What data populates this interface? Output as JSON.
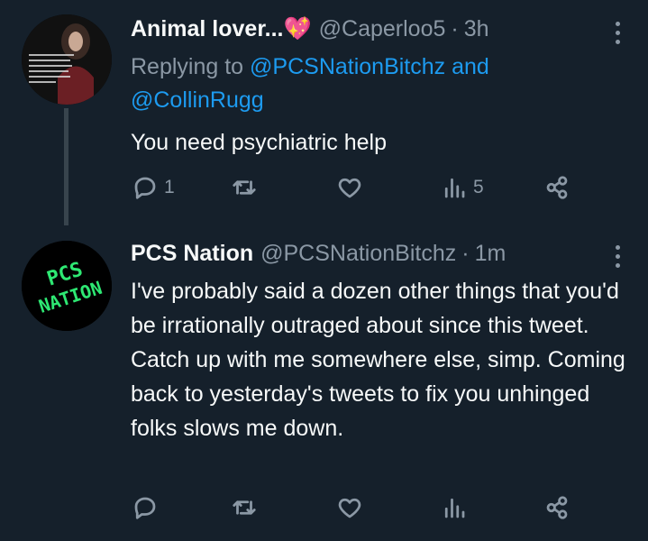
{
  "tweets": [
    {
      "name": "Animal lover...💖",
      "handle": "@Caperloo5",
      "separator": "·",
      "time": "3h",
      "reply_prefix": "Replying to",
      "reply_user1": "@PCSNationBitchz",
      "reply_and": "and",
      "reply_user2": "@CollinRugg",
      "text": "You need psychiatric help",
      "avatar_caption": "The disintegration of Roe v. Wade will change your lives in an irreversible way... You will not have control of what your beautiful dreams meant for you.",
      "counts": {
        "reply": "1",
        "retweet": "",
        "like": "",
        "views": "5"
      }
    },
    {
      "name": "PCS Nation",
      "handle": "@PCSNationBitchz",
      "separator": "·",
      "time": "1m",
      "text": "I've probably said a dozen other things that you'd be irrationally outraged about since this tweet. Catch up with me somewhere else, simp. Coming back to yesterday's tweets to fix you unhinged folks slows me down.",
      "avatar_logo_line1": "PCS",
      "avatar_logo_line2": "NATION",
      "counts": {
        "reply": "",
        "retweet": "",
        "like": "",
        "views": ""
      }
    }
  ],
  "colors": {
    "background": "#15202b",
    "muted": "#8b98a5",
    "link": "#1d9bf0",
    "logo": "#2ee873"
  },
  "icons": [
    "reply-icon",
    "retweet-icon",
    "like-icon",
    "views-icon",
    "share-icon",
    "more-icon"
  ]
}
